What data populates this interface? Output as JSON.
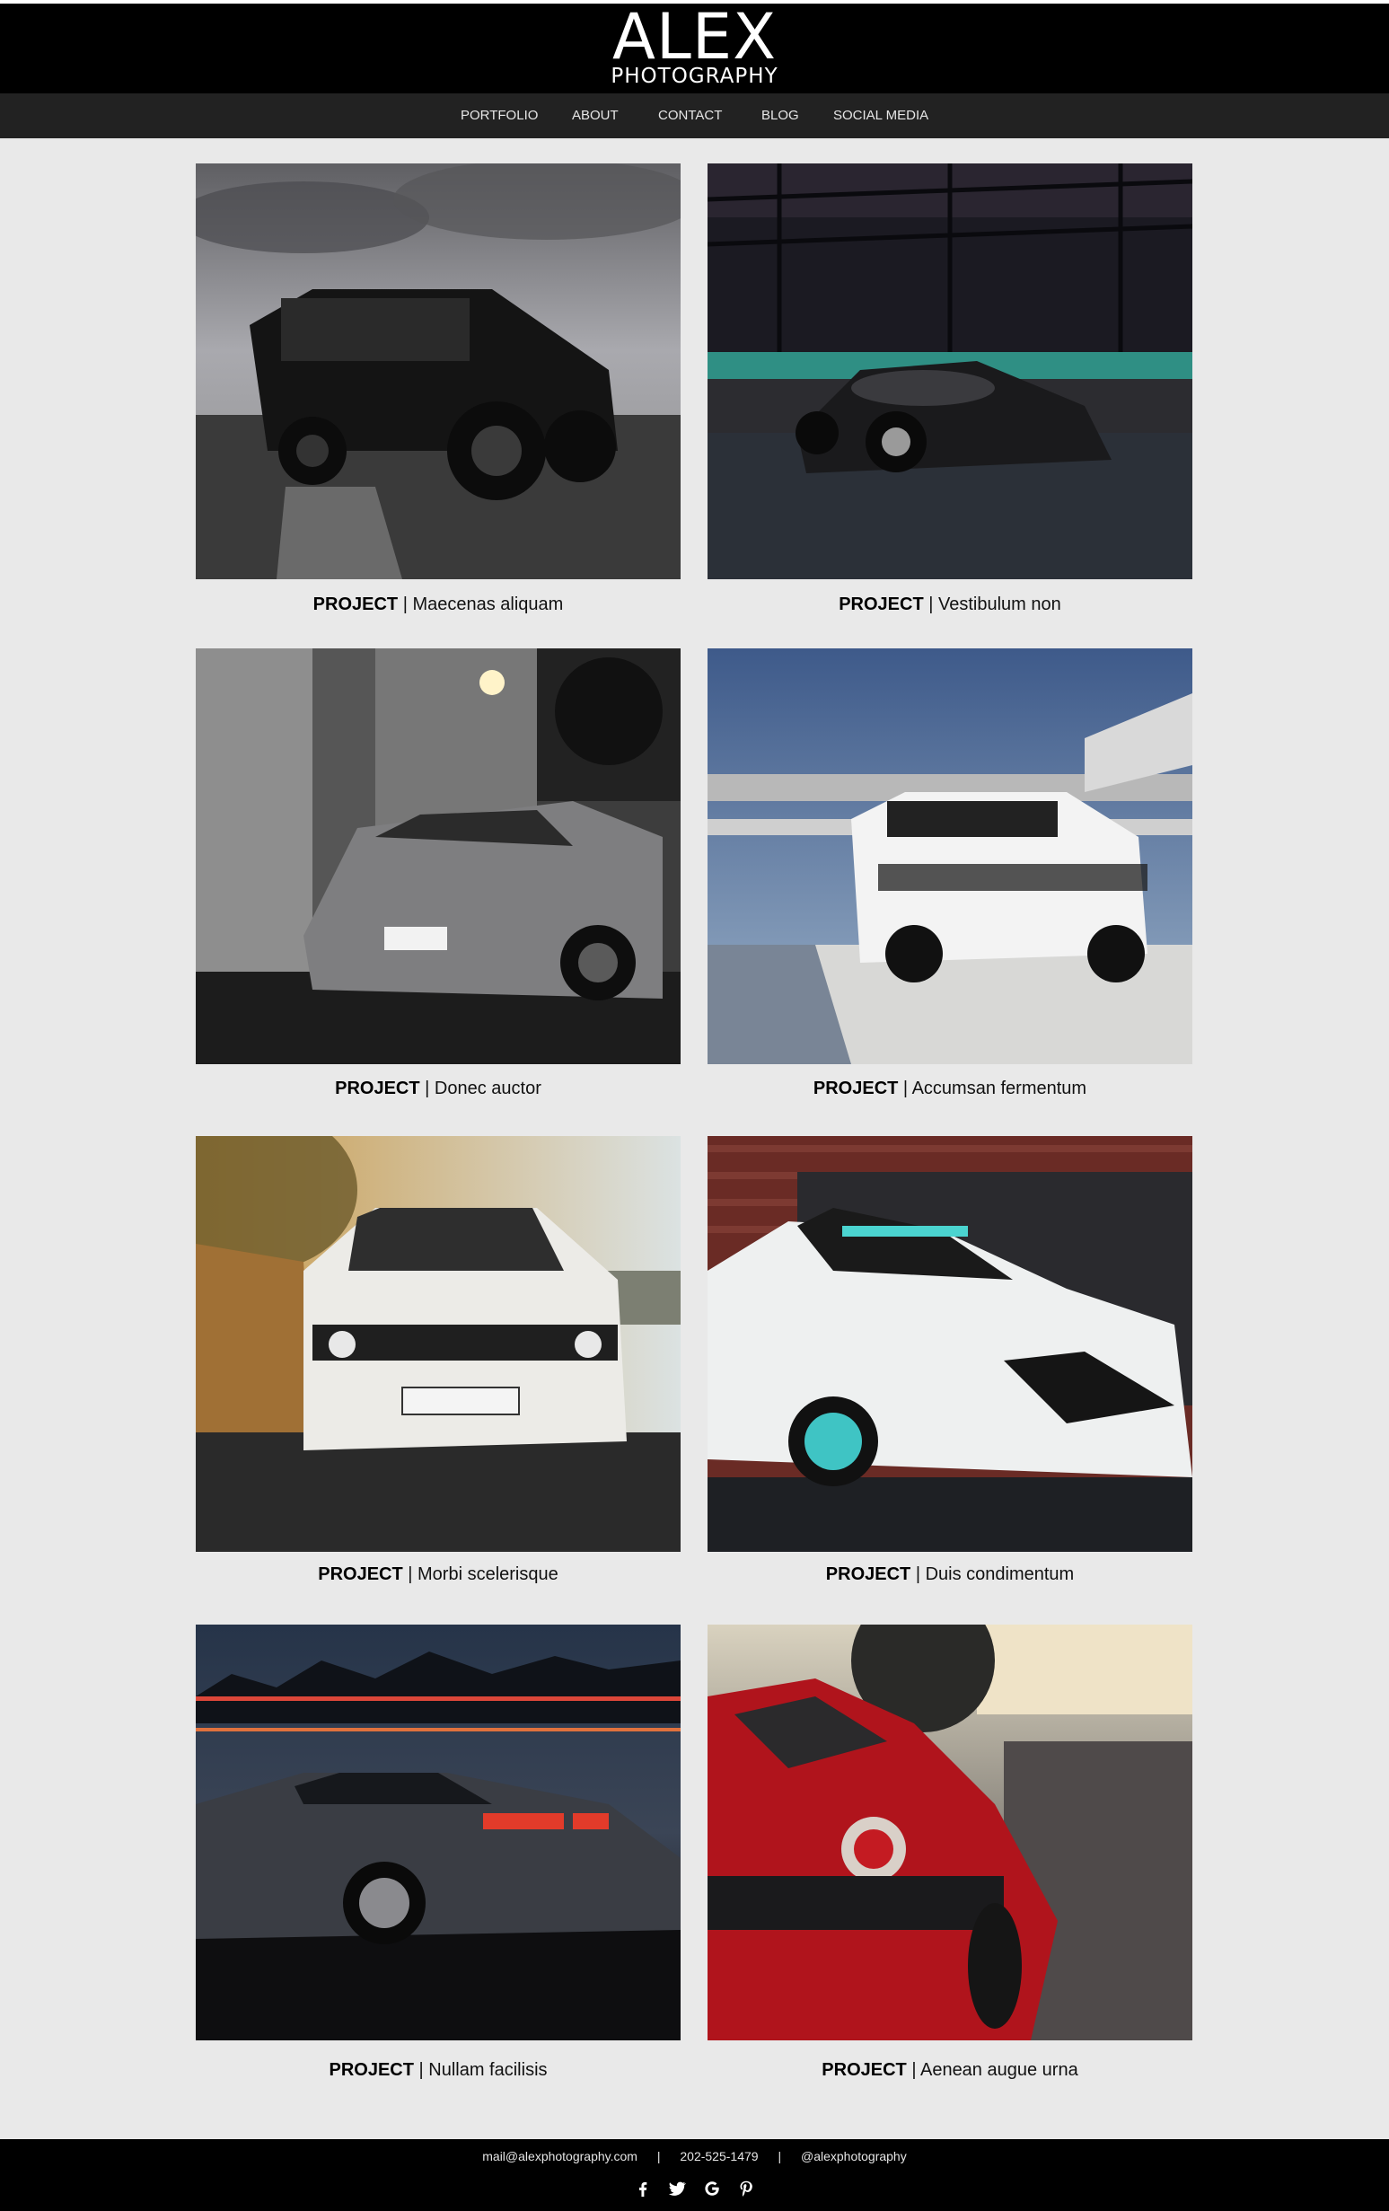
{
  "brand": {
    "title": "ALEX",
    "subtitle": "PHOTOGRAPHY"
  },
  "nav": [
    {
      "label": "PORTFOLIO"
    },
    {
      "label": "ABOUT"
    },
    {
      "label": "CONTACT"
    },
    {
      "label": "BLOG"
    },
    {
      "label": "SOCIAL MEDIA"
    }
  ],
  "projects": [
    {
      "label": "PROJECT",
      "title": "| Maecenas aliquam"
    },
    {
      "label": "PROJECT",
      "title": "|  Vestibulum non"
    },
    {
      "label": "PROJECT",
      "title": "| Donec auctor"
    },
    {
      "label": "PROJECT",
      "title": "|  Accumsan fermentum"
    },
    {
      "label": "PROJECT",
      "title": "| Morbi scelerisque"
    },
    {
      "label": "PROJECT",
      "title": "|  Duis condimentum"
    },
    {
      "label": "PROJECT",
      "title": "| Nullam facilisis"
    },
    {
      "label": "PROJECT",
      "title": "|  Aenean augue urna"
    }
  ],
  "footer": {
    "email": "mail@alexphotography.com",
    "phone": "202-525-1479",
    "handle": "@alexphotography",
    "separator": "|",
    "social_icons": [
      "facebook-icon",
      "twitter-icon",
      "google-icon",
      "pinterest-icon"
    ]
  },
  "colors": {
    "page_bg": "#e9e9e9",
    "header_bg": "#000000",
    "nav_bg": "#222222",
    "footer_bg": "#000000"
  }
}
